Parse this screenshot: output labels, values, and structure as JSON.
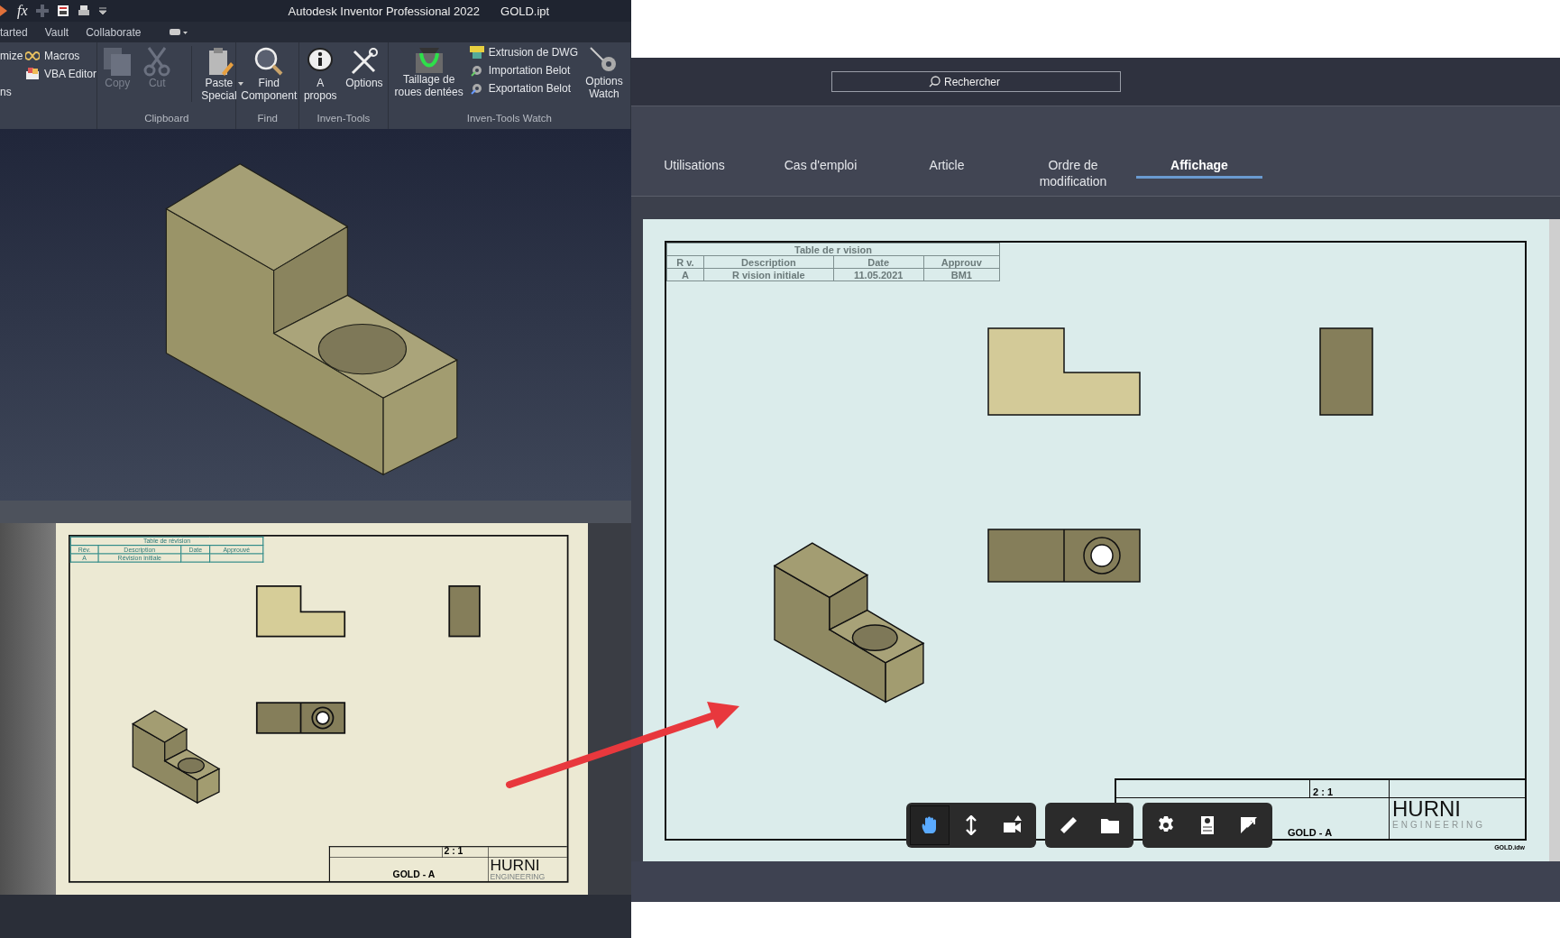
{
  "inventor": {
    "formula_symbol": "fx",
    "title": "Autodesk Inventor Professional 2022",
    "file": "GOLD.ipt",
    "tabs": [
      {
        "label": "tarted"
      },
      {
        "label": "Vault"
      },
      {
        "label": "Collaborate"
      }
    ],
    "ribbon": {
      "partial_group": {
        "cut_labels": [
          "mize",
          "ns"
        ],
        "items": [
          {
            "label": "Macros"
          },
          {
            "label": "VBA Editor"
          }
        ]
      },
      "clipboard": {
        "label": "Clipboard",
        "items": [
          {
            "label": "Copy",
            "disabled": true
          },
          {
            "label": "Cut",
            "disabled": true
          },
          {
            "label": "Paste Special",
            "disabled": false
          }
        ]
      },
      "find": {
        "label": "Find",
        "items": [
          {
            "label": "Find Component"
          }
        ]
      },
      "inven_tools": {
        "label": "Inven-Tools",
        "items": [
          {
            "label": "A propos"
          },
          {
            "label": "Options"
          }
        ]
      },
      "inven_tools_watch": {
        "label": "Inven-Tools Watch",
        "items": [
          {
            "label": "Taillage de roues dentées"
          },
          {
            "label": "Extrusion de DWG"
          },
          {
            "label": "Importation Belot"
          },
          {
            "label": "Exportation Belot"
          },
          {
            "label": "Options Watch"
          }
        ]
      }
    },
    "drawing": {
      "revision_table": {
        "title": "Table de révision",
        "columns": [
          "Rév.",
          "Description",
          "Date",
          "Approuvé"
        ],
        "rows": [
          [
            "A",
            "Révision initiale"
          ]
        ]
      },
      "title_block": {
        "scale": "2 : 1",
        "drawing_number": "GOLD - A",
        "logo": "HURNI",
        "logo_tagline": "ENGINEERING"
      }
    }
  },
  "viewer": {
    "search": {
      "placeholder": "Rechercher"
    },
    "tabs": [
      {
        "label": "Utilisations",
        "selected": false
      },
      {
        "label": "Cas d'emploi",
        "selected": false
      },
      {
        "label": "Article",
        "selected": false
      },
      {
        "label": "Ordre de modification",
        "selected": false
      },
      {
        "label": "Affichage",
        "selected": true
      }
    ],
    "sheet": {
      "revision_table": {
        "title": "Table de r vision",
        "columns": [
          "R v.",
          "Description",
          "Date",
          "Approuv"
        ],
        "rows": [
          [
            "A",
            "R vision initiale",
            "11.05.2021",
            "BM1"
          ]
        ]
      },
      "title_block": {
        "scale": "2 : 1",
        "drawing_number": "GOLD - A",
        "logo": "HURNI",
        "logo_tagline": "ENGINEERING"
      },
      "file_name": "GOLD.idw"
    },
    "toolbar": [
      {
        "buttons": [
          {
            "selected": true
          },
          {
            "selected": false
          },
          {
            "selected": false
          }
        ]
      },
      {
        "buttons": [
          {
            "selected": false
          },
          {
            "selected": false
          }
        ]
      },
      {
        "buttons": [
          {
            "selected": false
          },
          {
            "selected": false
          },
          {
            "selected": false
          }
        ]
      }
    ]
  }
}
